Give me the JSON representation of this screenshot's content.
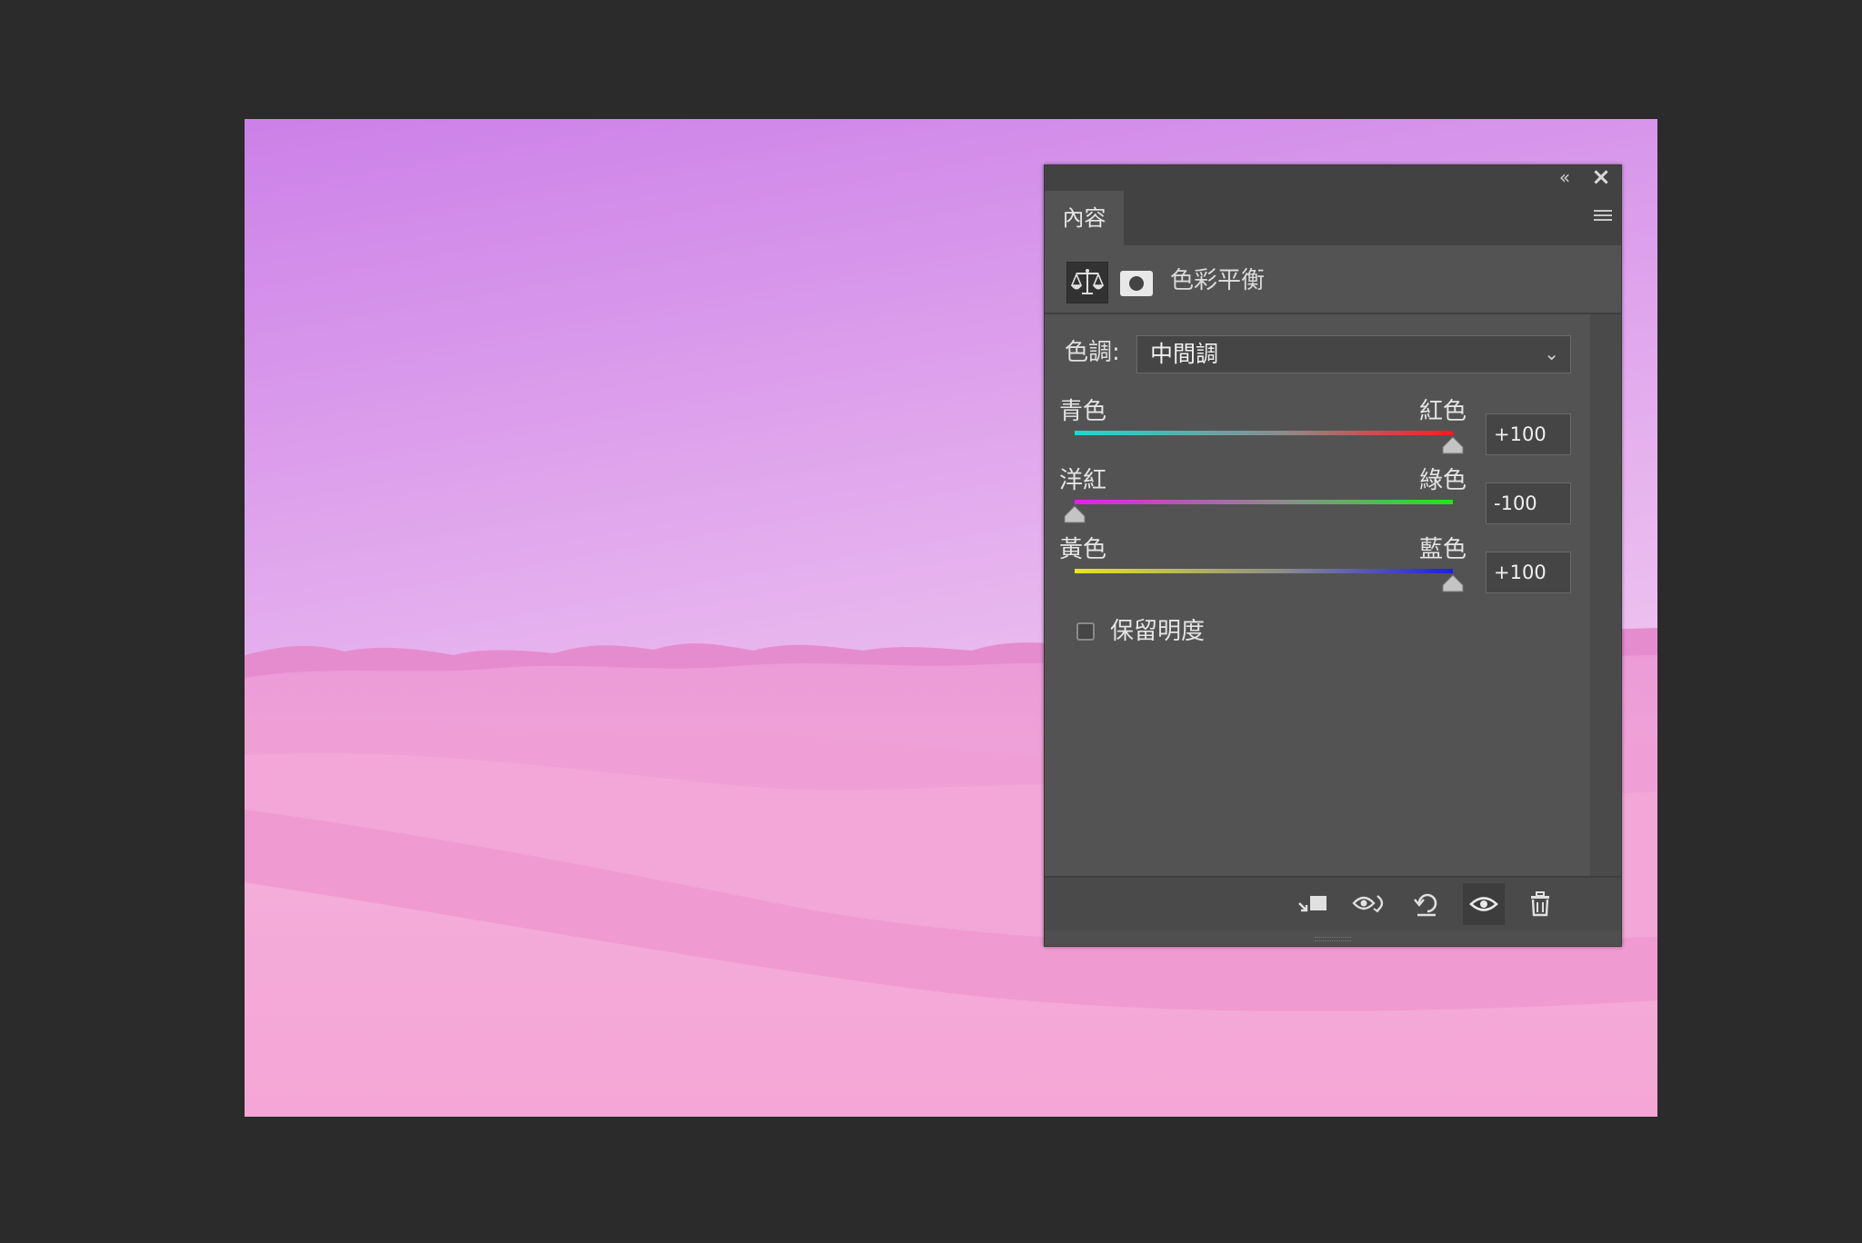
{
  "panel": {
    "tab_label": "內容",
    "adjustment_title": "色彩平衡",
    "tone_label": "色調:",
    "tone_value": "中間調",
    "sliders": [
      {
        "left_label": "青色",
        "right_label": "紅色",
        "value": "+100",
        "level": 100
      },
      {
        "left_label": "洋紅",
        "right_label": "綠色",
        "value": "-100",
        "level": -100
      },
      {
        "left_label": "黃色",
        "right_label": "藍色",
        "value": "+100",
        "level": 100
      }
    ],
    "preserve_luminosity_label": "保留明度",
    "preserve_luminosity_checked": false,
    "icons": {
      "collapse": "collapse-panel-icon",
      "close": "close-icon",
      "menu": "panel-menu-icon",
      "balance": "color-balance-icon",
      "mask": "layer-mask-icon",
      "clip": "clip-to-layer-icon",
      "view_previous": "view-previous-state-icon",
      "reset": "reset-icon",
      "visibility": "toggle-visibility-icon",
      "delete": "trash-icon"
    }
  },
  "colors": {
    "panel_bg": "#535353",
    "sky_top": "#c97be6",
    "sand": "#f1a5d8"
  }
}
